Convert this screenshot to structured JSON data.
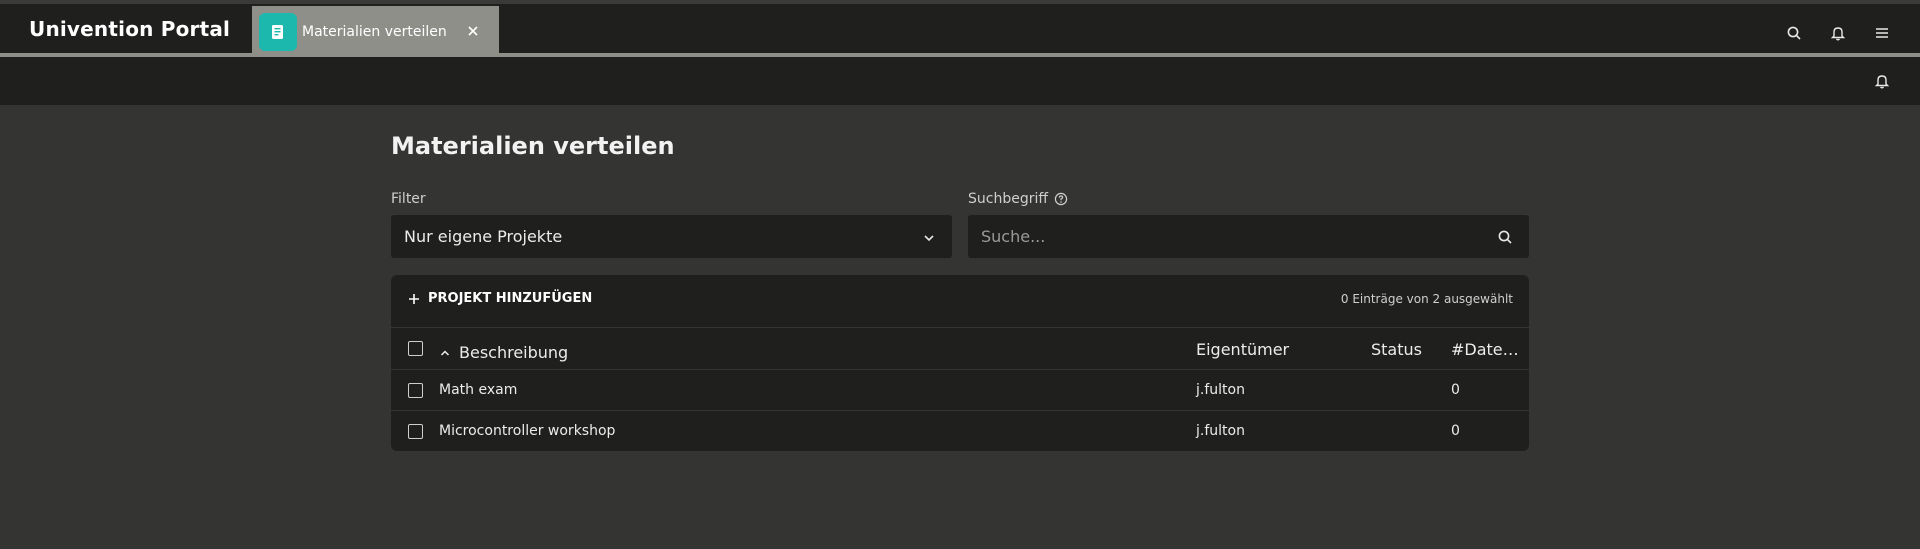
{
  "header": {
    "brand": "Univention Portal",
    "tab": {
      "label": "Materialien verteilen",
      "icon": "document-icon",
      "close_icon": "close-icon"
    },
    "actions": [
      {
        "name": "search-icon"
      },
      {
        "name": "bell-icon"
      },
      {
        "name": "menu-icon"
      }
    ]
  },
  "subheader": {
    "bell_icon": "bell-icon"
  },
  "page": {
    "title": "Materialien verteilen",
    "filter": {
      "label": "Filter",
      "value": "Nur eigene Projekte"
    },
    "search": {
      "label": "Suchbegriff",
      "placeholder": "Suche..."
    }
  },
  "table": {
    "add_button": "PROJEKT HINZUFÜGEN",
    "selection_info": "0 Einträge von 2 ausgewählt",
    "columns": [
      "Beschreibung",
      "Eigentümer",
      "Status",
      "#Date…"
    ],
    "rows": [
      {
        "description": "Math exam",
        "owner": "j.fulton",
        "status": "",
        "files": "0"
      },
      {
        "description": "Microcontroller workshop",
        "owner": "j.fulton",
        "status": "",
        "files": "0"
      }
    ]
  },
  "colors": {
    "accent": "#1db8ad",
    "header_bg": "#1f1f1e",
    "page_bg": "#343433",
    "tab_bg": "#8f8f8a"
  }
}
